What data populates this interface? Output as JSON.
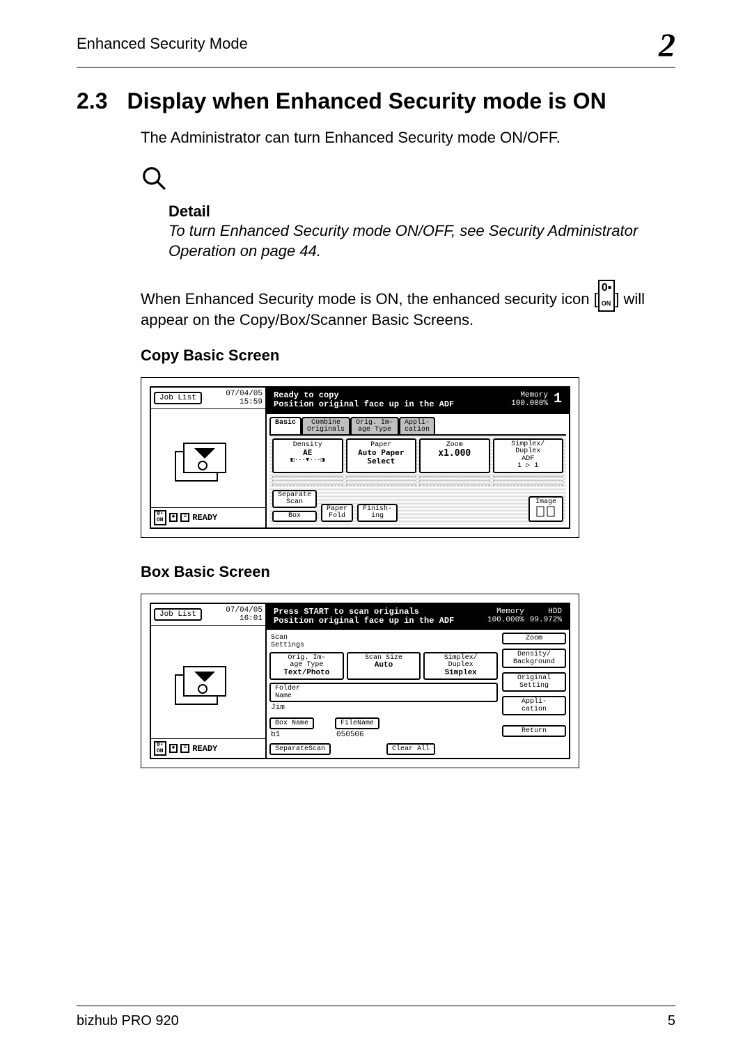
{
  "header": {
    "section": "Enhanced Security Mode",
    "chapter": "2"
  },
  "section": {
    "num": "2.3",
    "title": "Display when Enhanced Security mode is ON"
  },
  "intro": "The Administrator can turn Enhanced Security mode ON/OFF.",
  "detail": {
    "label": "Detail",
    "text": "To turn Enhanced Security mode ON/OFF, see Security Administrator Operation on page 44."
  },
  "icon_note_before": "When Enhanced Security mode is ON, the enhanced security icon [",
  "icon_note_after": "] will appear on the Copy/Box/Scanner Basic Screens.",
  "inline_icon": {
    "top": "0▪",
    "bottom": "ON"
  },
  "copy_heading": "Copy Basic Screen",
  "box_heading": "Box Basic Screen",
  "copy_screen": {
    "job_list": "Job List",
    "date": "07/04/05",
    "time": "15:59",
    "status1": "Ready to copy",
    "status2": "Position original face up in the ADF",
    "memory_label": "Memory",
    "memory_val": "100.000%",
    "count": "1",
    "tabs": [
      "Basic",
      "Combine\nOriginals",
      "Orig. Im-\nage Type",
      "Appli-\ncation"
    ],
    "density_label": "Density",
    "density_val": "AE",
    "paper_label": "Paper",
    "paper_val": "Auto Paper\nSelect",
    "zoom_label": "Zoom",
    "zoom_val": "x1.000",
    "duplex_label": "Simplex/\nDuplex",
    "duplex_val1": "ADF",
    "duplex_val2": "1 ▷ 1",
    "separate_scan": "Separate\nScan",
    "box": "Box",
    "paper_fold": "Paper\nFold",
    "finishing": "Finish-\ning",
    "image": "Image",
    "ready_icon_top": "0▪",
    "ready_icon_bottom": "ON",
    "ready": "READY"
  },
  "box_screen": {
    "job_list": "Job List",
    "date": "07/04/05",
    "time": "16:01",
    "status1": "Press START to scan originals",
    "status2": "Position original face up in the ADF",
    "memory_label": "Memory",
    "memory_val": "100.000%",
    "hdd_label": "HDD",
    "hdd_val": "99.972%",
    "scan_settings": "Scan\nSettings",
    "orig_img_label": "Orig. Im-\nage Type",
    "orig_img_val": "Text/Photo",
    "scan_size_label": "Scan Size",
    "scan_size_val": "Auto",
    "duplex_label": "Simplex/\nDuplex",
    "duplex_val": "Simplex",
    "side_zoom": "Zoom",
    "side_density": "Density/\nBackground",
    "side_orig": "Original\nSetting",
    "side_app": "Appli-\ncation",
    "folder_name_btn": "Folder\nName",
    "folder_name_val": "Jim",
    "box_name_btn": "Box Name",
    "box_name_val": "b1",
    "file_name_btn": "FileName",
    "file_name_val": "050506",
    "separate_scan": "SeparateScan",
    "clear_all": "Clear All",
    "return": "Return",
    "ready_icon_top": "0▪",
    "ready_icon_bottom": "ON",
    "ready": "READY"
  },
  "footer": {
    "product": "bizhub PRO 920",
    "page": "5"
  }
}
